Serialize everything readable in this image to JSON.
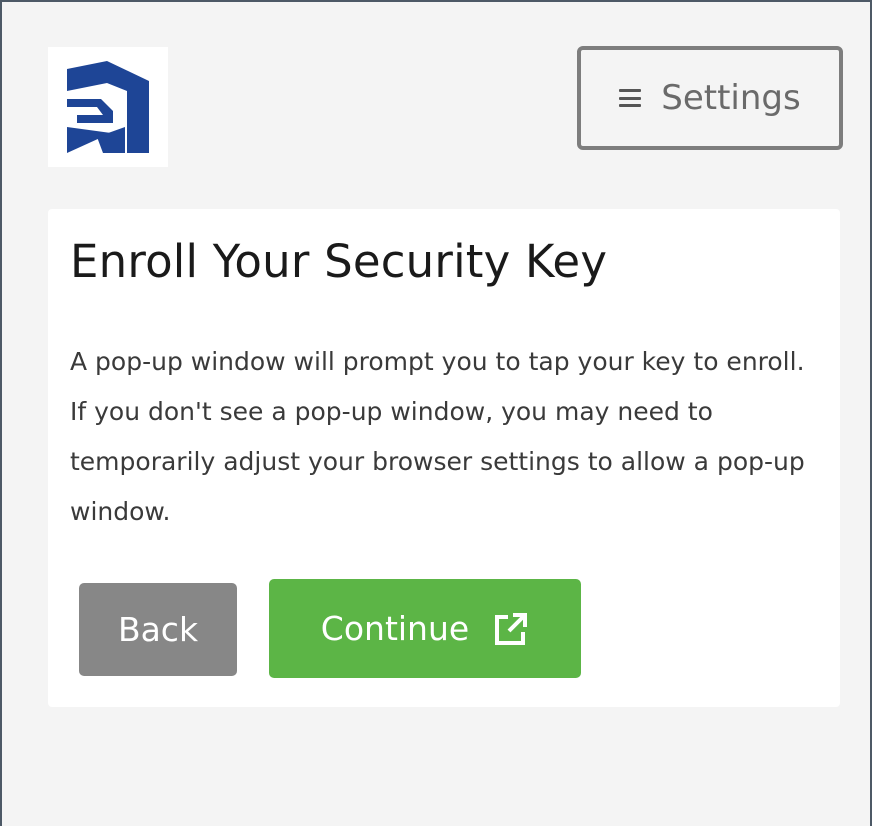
{
  "header": {
    "logo_icon": "brand-logo-icon",
    "settings_button": {
      "label": "Settings",
      "icon": "hamburger-menu-icon"
    }
  },
  "enroll": {
    "title": "Enroll Your Security Key",
    "description": "A pop-up window will prompt you to tap your key to enroll. If you don't see a pop-up window, you may need to temporarily adjust your browser settings to allow a pop-up window.",
    "back_label": "Back",
    "continue_label": "Continue",
    "continue_icon": "external-link-icon"
  },
  "colors": {
    "brand_blue": "#1e4596",
    "back_gray": "#878787",
    "continue_green": "#5cb546",
    "frame_border": "#4d5966"
  }
}
